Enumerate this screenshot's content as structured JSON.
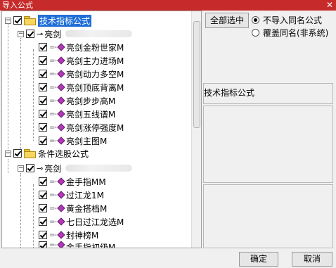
{
  "window": {
    "title": "导入公式",
    "close_glyph": "✕"
  },
  "tree": {
    "group1": {
      "label": "技术指标公式",
      "sub": {
        "label": "亮剑"
      },
      "items": [
        "亮剑金粉世家M",
        "亮剑主力进场M",
        "亮剑动力多空M",
        "亮剑顶底背离M",
        "亮剑步步高M",
        "亮剑五线谱M",
        "亮剑涨停强度M",
        "亮剑主图M"
      ]
    },
    "group2": {
      "label": "条件选股公式",
      "sub": {
        "label": "亮剑"
      },
      "items": [
        "金手指MM",
        "过江龙1M",
        "黄金搭档M",
        "七日过江龙选M",
        "封神榜M",
        "金手指初级M"
      ]
    }
  },
  "right": {
    "select_all": "全部选中",
    "radio_options": [
      "不导入同名公式",
      "覆盖同名(非系统)"
    ],
    "selected_radio": 0,
    "panel_title": "技术指标公式"
  },
  "footer": {
    "ok": "确定",
    "cancel": "取消"
  },
  "colors": {
    "titlebar": "#c72a2a",
    "selection": "#1f6fd6"
  }
}
